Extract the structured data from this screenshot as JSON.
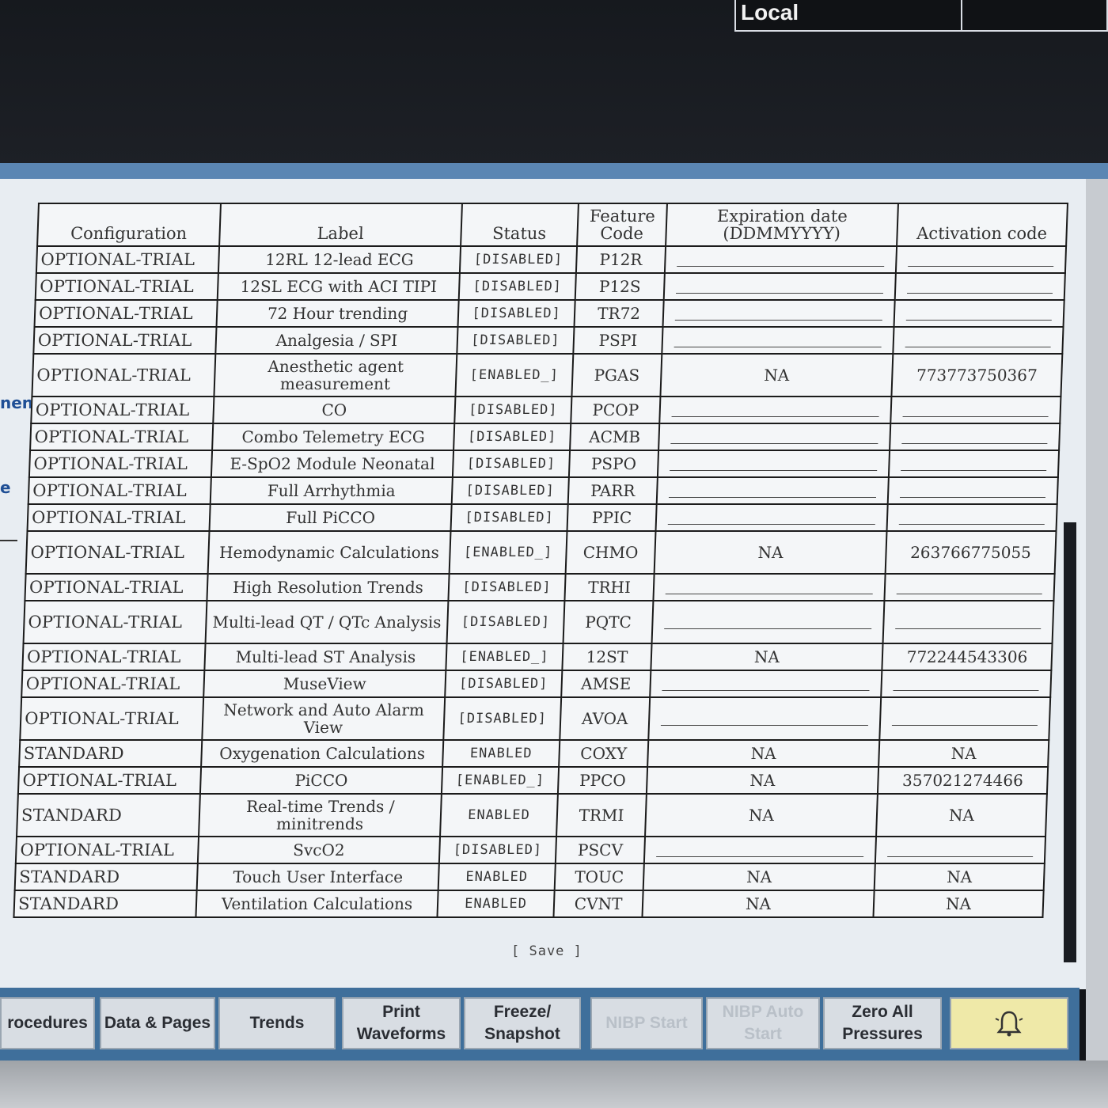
{
  "header": {
    "mode_label": "Local"
  },
  "side_clips": {
    "first": "nent",
    "second": "e"
  },
  "table": {
    "headers": [
      "Configuration",
      "Label",
      "Status",
      "Feature Code",
      "Expiration date (DDMMYYYY)",
      "Activation code"
    ],
    "rows": [
      {
        "config": "OPTIONAL-TRIAL",
        "label": "12RL 12-lead ECG",
        "status": "[DISABLED]",
        "code": "P12R",
        "expiration": "",
        "activation": ""
      },
      {
        "config": "OPTIONAL-TRIAL",
        "label": "12SL ECG with ACI TIPI",
        "status": "[DISABLED]",
        "code": "P12S",
        "expiration": "",
        "activation": ""
      },
      {
        "config": "OPTIONAL-TRIAL",
        "label": "72 Hour trending",
        "status": "[DISABLED]",
        "code": "TR72",
        "expiration": "",
        "activation": ""
      },
      {
        "config": "OPTIONAL-TRIAL",
        "label": "Analgesia / SPI",
        "status": "[DISABLED]",
        "code": "PSPI",
        "expiration": "",
        "activation": ""
      },
      {
        "config": "OPTIONAL-TRIAL",
        "label": "Anesthetic agent measurement",
        "status": "[ENABLED_]",
        "code": "PGAS",
        "expiration": "NA",
        "activation": "773773750367"
      },
      {
        "config": "OPTIONAL-TRIAL",
        "label": "CO",
        "status": "[DISABLED]",
        "code": "PCOP",
        "expiration": "",
        "activation": ""
      },
      {
        "config": "OPTIONAL-TRIAL",
        "label": "Combo Telemetry ECG",
        "status": "[DISABLED]",
        "code": "ACMB",
        "expiration": "",
        "activation": ""
      },
      {
        "config": "OPTIONAL-TRIAL",
        "label": "E-SpO2 Module Neonatal",
        "status": "[DISABLED]",
        "code": "PSPO",
        "expiration": "",
        "activation": ""
      },
      {
        "config": "OPTIONAL-TRIAL",
        "label": "Full Arrhythmia",
        "status": "[DISABLED]",
        "code": "PARR",
        "expiration": "",
        "activation": ""
      },
      {
        "config": "OPTIONAL-TRIAL",
        "label": "Full PiCCO",
        "status": "[DISABLED]",
        "code": "PPIC",
        "expiration": "",
        "activation": ""
      },
      {
        "config": "OPTIONAL-TRIAL",
        "label": "Hemodynamic Calculations",
        "status": "[ENABLED_]",
        "code": "CHMO",
        "expiration": "NA",
        "activation": "263766775055"
      },
      {
        "config": "OPTIONAL-TRIAL",
        "label": "High Resolution Trends",
        "status": "[DISABLED]",
        "code": "TRHI",
        "expiration": "",
        "activation": ""
      },
      {
        "config": "OPTIONAL-TRIAL",
        "label": "Multi-lead QT / QTc Analysis",
        "status": "[DISABLED]",
        "code": "PQTC",
        "expiration": "",
        "activation": ""
      },
      {
        "config": "OPTIONAL-TRIAL",
        "label": "Multi-lead ST Analysis",
        "status": "[ENABLED_]",
        "code": "12ST",
        "expiration": "NA",
        "activation": "772244543306"
      },
      {
        "config": "OPTIONAL-TRIAL",
        "label": "MuseView",
        "status": "[DISABLED]",
        "code": "AMSE",
        "expiration": "",
        "activation": ""
      },
      {
        "config": "OPTIONAL-TRIAL",
        "label": "Network and Auto Alarm View",
        "status": "[DISABLED]",
        "code": "AVOA",
        "expiration": "",
        "activation": ""
      },
      {
        "config": "STANDARD",
        "label": "Oxygenation Calculations",
        "status": "ENABLED",
        "code": "COXY",
        "expiration": "NA",
        "activation": "NA"
      },
      {
        "config": "OPTIONAL-TRIAL",
        "label": "PiCCO",
        "status": "[ENABLED_]",
        "code": "PPCO",
        "expiration": "NA",
        "activation": "357021274466"
      },
      {
        "config": "STANDARD",
        "label": "Real-time Trends / minitrends",
        "status": "ENABLED",
        "code": "TRMI",
        "expiration": "NA",
        "activation": "NA"
      },
      {
        "config": "OPTIONAL-TRIAL",
        "label": "SvcO2",
        "status": "[DISABLED]",
        "code": "PSCV",
        "expiration": "",
        "activation": ""
      },
      {
        "config": "STANDARD",
        "label": "Touch User Interface",
        "status": "ENABLED",
        "code": "TOUC",
        "expiration": "NA",
        "activation": "NA"
      },
      {
        "config": "STANDARD",
        "label": "Ventilation Calculations",
        "status": "ENABLED",
        "code": "CVNT",
        "expiration": "NA",
        "activation": "NA"
      }
    ]
  },
  "save_label": "[ Save ]",
  "toolbar": {
    "buttons": [
      {
        "label": "rocedures",
        "disabled": false
      },
      {
        "label": "Data & Pages",
        "disabled": false
      },
      {
        "label": "Trends",
        "disabled": false
      },
      {
        "label": "Print Waveforms",
        "disabled": false
      },
      {
        "label": "Freeze/ Snapshot",
        "disabled": false
      },
      {
        "label": "NIBP Start",
        "disabled": true
      },
      {
        "label": "NIBP Auto Start",
        "disabled": true
      },
      {
        "label": "Zero All Pressures",
        "disabled": false
      },
      {
        "label": "",
        "disabled": false,
        "icon": "alarm-bell-icon"
      }
    ]
  },
  "colors": {
    "toolbar": "#3f6f9b",
    "screen_bg": "#e8edf2",
    "alarm_button": "#efe9a8",
    "side_text": "#1f4f95"
  }
}
